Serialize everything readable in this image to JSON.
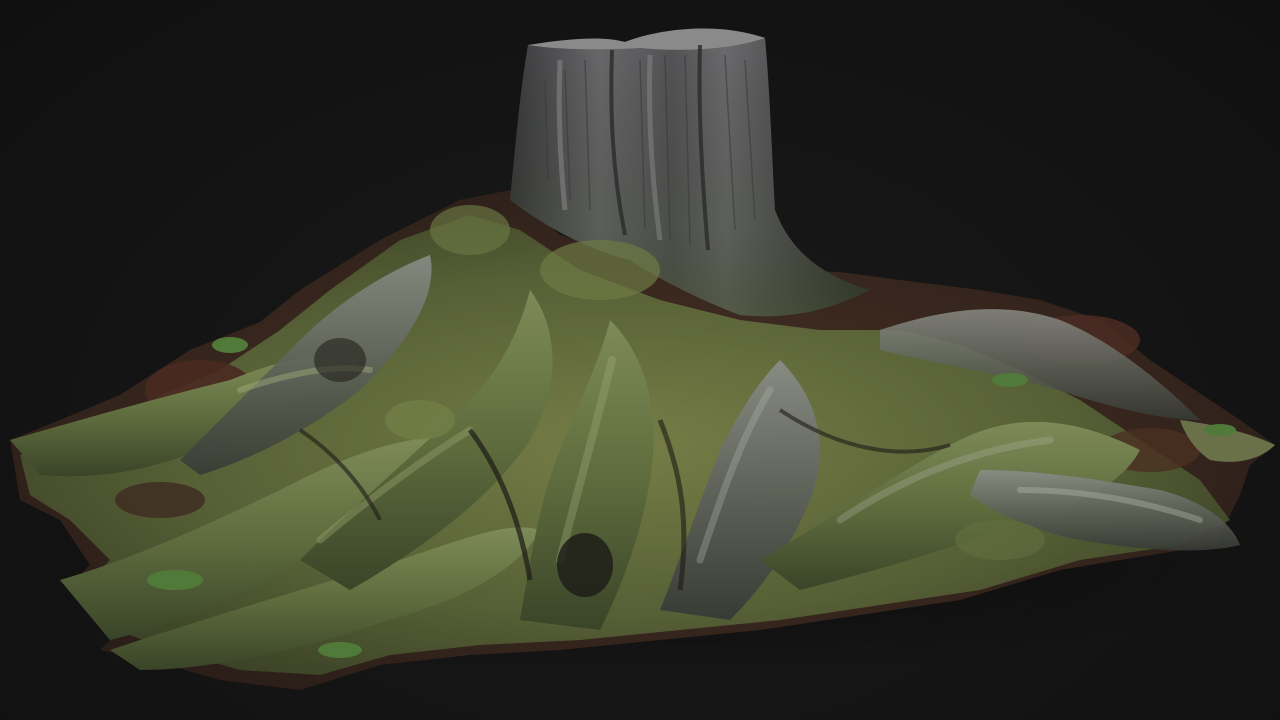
{
  "scene": {
    "subject": "tree-stump-with-roots",
    "background_color": "#121212",
    "colors": {
      "bark": "#4a4a4c",
      "bark_light": "#6e6e70",
      "bark_dark": "#2c2c2e",
      "moss": "#5d6b3a",
      "moss_light": "#7d8a4c",
      "soil": "#3a2a22",
      "leaf_litter": "#5a3424",
      "grass": "#4f7a3a"
    }
  }
}
